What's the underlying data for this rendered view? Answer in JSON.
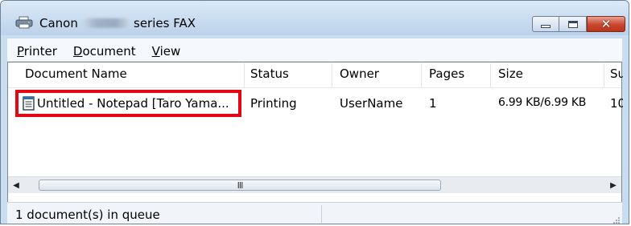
{
  "window": {
    "title_prefix": "Canon",
    "title_suffix": "series FAX"
  },
  "menu": [
    {
      "accel": "P",
      "rest": "rinter"
    },
    {
      "accel": "D",
      "rest": "ocument"
    },
    {
      "accel": "V",
      "rest": "iew"
    }
  ],
  "columns": [
    "Document Name",
    "Status",
    "Owner",
    "Pages",
    "Size",
    "Sul"
  ],
  "rows": [
    {
      "document_name": "Untitled - Notepad [Taro Yama...",
      "status": "Printing",
      "owner": "UserName",
      "pages": "1",
      "size": "6.99 KB/6.99 KB",
      "submitted": "10:"
    }
  ],
  "scrollbar": {
    "grip": "III"
  },
  "status": {
    "text": "1 document(s) in queue"
  },
  "colors": {
    "highlight": "#e30613",
    "title_bar": "#c9ddf1",
    "close_button": "#c9452d"
  },
  "icons": [
    "printer-fax-icon",
    "minimize-icon",
    "maximize-icon",
    "close-icon",
    "document-icon",
    "scroll-left-icon",
    "scroll-right-icon",
    "size-grip-icon"
  ]
}
